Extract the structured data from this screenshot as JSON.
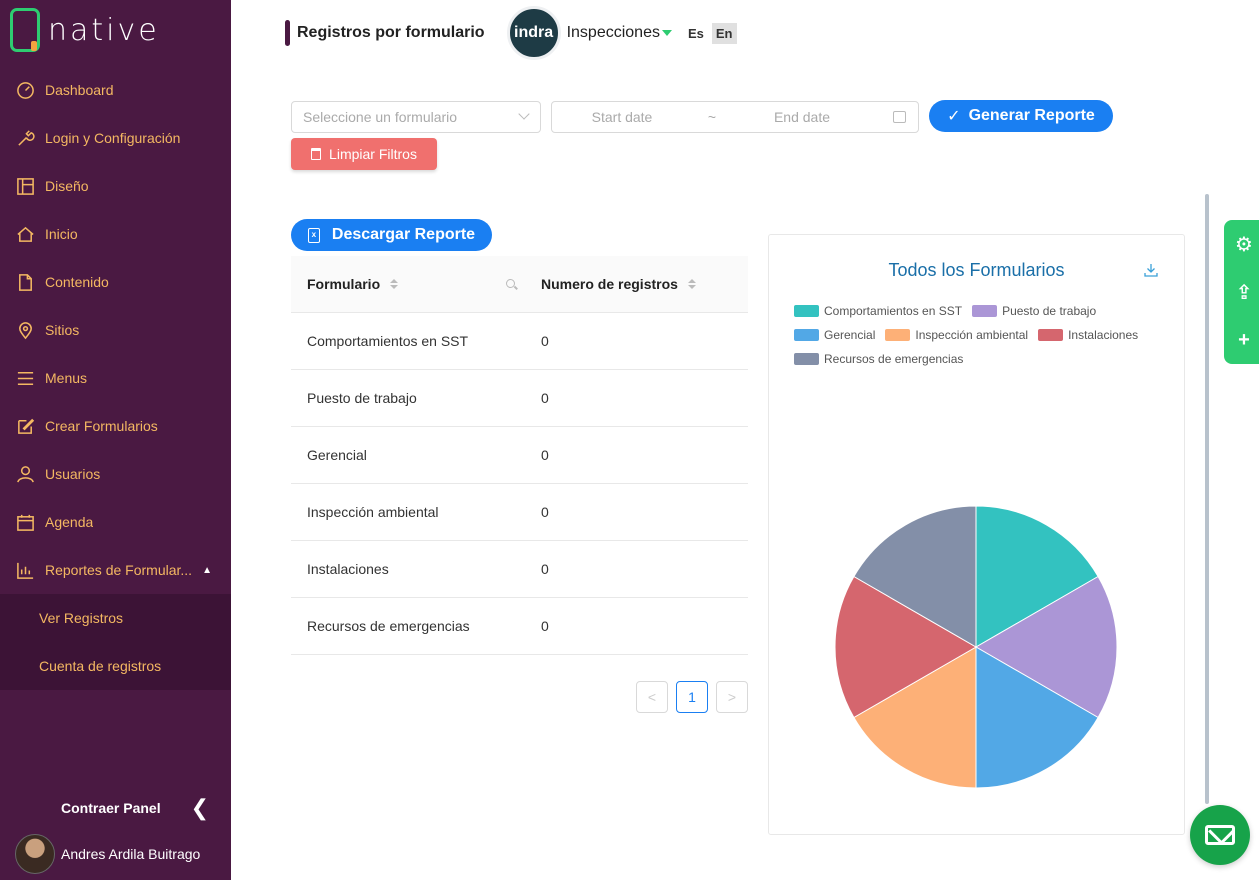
{
  "app": {
    "logo_text": "native"
  },
  "sidebar": {
    "items": [
      {
        "label": "Dashboard",
        "icon": "gauge-icon"
      },
      {
        "label": "Login y Configuración",
        "icon": "wrench-icon"
      },
      {
        "label": "Diseño",
        "icon": "layout-icon"
      },
      {
        "label": "Inicio",
        "icon": "home-icon"
      },
      {
        "label": "Contenido",
        "icon": "file-icon"
      },
      {
        "label": "Sitios",
        "icon": "location-pin-icon"
      },
      {
        "label": "Menus",
        "icon": "menu-icon"
      },
      {
        "label": "Crear Formularios",
        "icon": "edit-icon"
      },
      {
        "label": "Usuarios",
        "icon": "user-icon"
      },
      {
        "label": "Agenda",
        "icon": "calendar-icon"
      },
      {
        "label": "Reportes de Formular...",
        "icon": "bar-chart-icon"
      }
    ],
    "submenu": [
      {
        "label": "Ver Registros"
      },
      {
        "label": "Cuenta de registros"
      }
    ],
    "collapse_label": "Contraer Panel",
    "user_name": "Andres Ardila Buitrago"
  },
  "header": {
    "title": "Registros por formulario",
    "company_logo_text": "indra",
    "company_select": "Inspecciones",
    "lang_es": "Es",
    "lang_en": "En"
  },
  "filters": {
    "form_placeholder": "Seleccione un formulario",
    "start_date": "Start date",
    "date_sep": "~",
    "end_date": "End date",
    "generate_label": "Generar Reporte",
    "clear_label": "Limpiar Filtros"
  },
  "download_label": "Descargar Reporte",
  "table": {
    "col1": "Formulario",
    "col2": "Numero de registros",
    "rows": [
      {
        "form": "Comportamientos en SST",
        "count": "0"
      },
      {
        "form": "Puesto de trabajo",
        "count": "0"
      },
      {
        "form": "Gerencial",
        "count": "0"
      },
      {
        "form": "Inspección ambiental",
        "count": "0"
      },
      {
        "form": "Instalaciones",
        "count": "0"
      },
      {
        "form": "Recursos de emergencias",
        "count": "0"
      }
    ],
    "pagination": {
      "prev": "<",
      "current": "1",
      "next": ">"
    }
  },
  "chart_data": {
    "type": "pie",
    "title": "Todos los Formularios",
    "categories": [
      "Comportamientos en SST",
      "Puesto de trabajo",
      "Gerencial",
      "Inspección ambiental",
      "Instalaciones",
      "Recursos de emergencias"
    ],
    "values": [
      1,
      1,
      1,
      1,
      1,
      1
    ],
    "colors": [
      "#33c2c0",
      "#ab96d6",
      "#52a8e6",
      "#fdb077",
      "#d5666e",
      "#838fa8"
    ],
    "legend_position": "top"
  },
  "float_tools": {
    "settings": "⚙",
    "share": "⇪",
    "add": "+"
  }
}
